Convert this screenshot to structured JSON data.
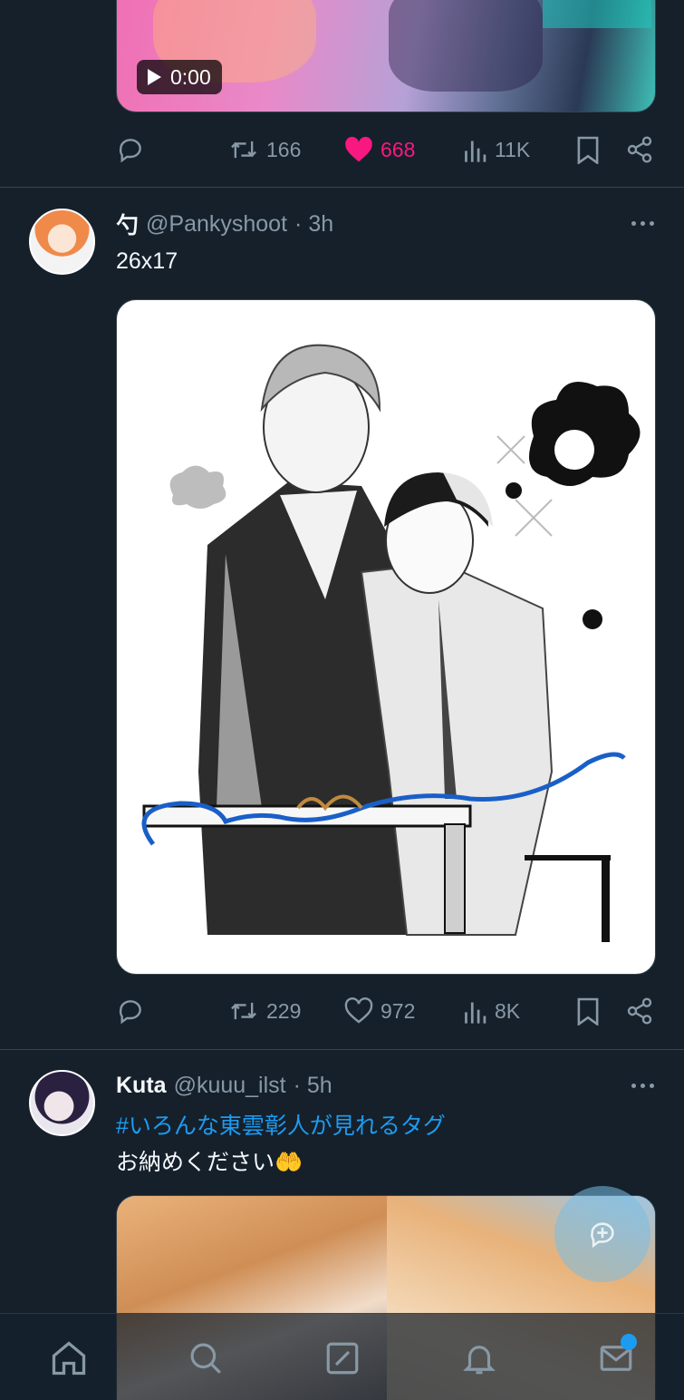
{
  "tweets": [
    {
      "media": {
        "type": "video",
        "duration": "0:00"
      },
      "stats": {
        "retweets": "166",
        "likes": "668",
        "views": "11K",
        "liked": true
      }
    },
    {
      "author": {
        "display_name": "勺",
        "handle": "@Pankyshoot",
        "time": "· 3h"
      },
      "text": "26x17",
      "stats": {
        "retweets": "229",
        "likes": "972",
        "views": "8K",
        "liked": false
      }
    },
    {
      "author": {
        "display_name": "Kuta",
        "handle": "@kuuu_ilst",
        "time": "· 5h"
      },
      "hashtag": "#いろんな東雲彰人が見れるタグ",
      "text": "お納めください🤲"
    }
  ],
  "icons": {
    "reply": "reply-icon",
    "retweet": "retweet-icon",
    "like": "heart-icon",
    "views": "views-icon",
    "bookmark": "bookmark-icon",
    "share": "share-icon",
    "more": "more-icon",
    "home": "home-icon",
    "search": "search-icon",
    "compose": "compose-icon",
    "notifications": "bell-icon",
    "messages": "mail-icon"
  },
  "colors": {
    "background": "#15202b",
    "like_active": "#f91880",
    "accent": "#1d9bf0",
    "muted": "#8899a6"
  }
}
